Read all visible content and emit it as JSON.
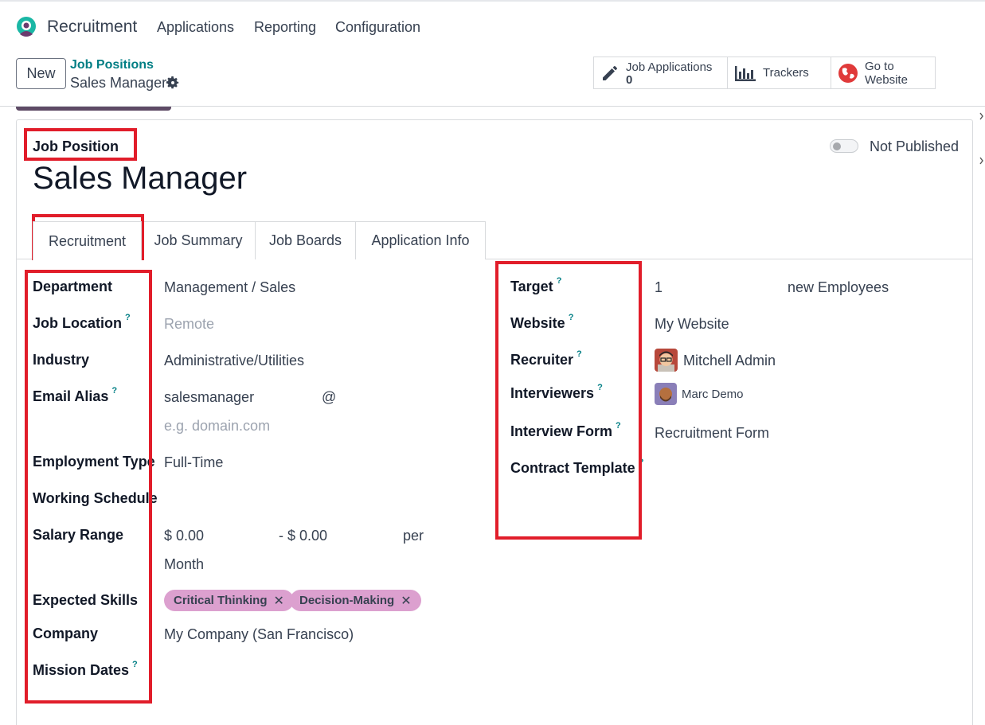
{
  "app": {
    "name": "Recruitment",
    "menu": [
      "Applications",
      "Reporting",
      "Configuration"
    ]
  },
  "control": {
    "new_label": "New",
    "breadcrumb_parent": "Job Positions",
    "breadcrumb_current": "Sales Manager",
    "smart_buttons": {
      "job_applications": {
        "label": "Job Applications",
        "value": "0"
      },
      "trackers": {
        "label": "Trackers"
      },
      "website": {
        "label_line1": "Go to",
        "label_line2": "Website"
      }
    }
  },
  "form": {
    "job_position_label": "Job Position",
    "title": "Sales Manager",
    "publish_status": "Not Published",
    "tabs": [
      "Recruitment",
      "Job Summary",
      "Job Boards",
      "Application Info"
    ],
    "left": {
      "department": {
        "label": "Department",
        "value": "Management / Sales"
      },
      "job_location": {
        "label": "Job Location",
        "help": "?",
        "placeholder": "Remote"
      },
      "industry": {
        "label": "Industry",
        "value": "Administrative/Utilities"
      },
      "email_alias": {
        "label": "Email Alias",
        "help": "?",
        "value": "salesmanager",
        "at": "@",
        "domain_placeholder": "e.g. domain.com"
      },
      "employment_type": {
        "label": "Employment Type",
        "value": "Full-Time"
      },
      "working_schedule": {
        "label": "Working Schedule"
      },
      "salary_range": {
        "label": "Salary Range",
        "min": "$ 0.00",
        "max": "- $ 0.00",
        "per": "per",
        "period": "Month"
      },
      "expected_skills": {
        "label": "Expected Skills",
        "tags": [
          "Critical Thinking",
          "Decision-Making"
        ],
        "remove_glyph": "✕"
      },
      "company": {
        "label": "Company",
        "value": "My Company (San Francisco)"
      },
      "mission_dates": {
        "label": "Mission Dates",
        "help": "?"
      }
    },
    "right": {
      "target": {
        "label": "Target",
        "help": "?",
        "value": "1",
        "unit": "new Employees"
      },
      "website": {
        "label": "Website",
        "help": "?",
        "value": "My Website"
      },
      "recruiter": {
        "label": "Recruiter",
        "help": "?",
        "value": "Mitchell Admin"
      },
      "interviewers": {
        "label": "Interviewers",
        "help": "?",
        "value": "Marc Demo"
      },
      "interview_form": {
        "label": "Interview Form",
        "help": "?",
        "value": "Recruitment Form"
      },
      "contract_template": {
        "label": "Contract Template",
        "help": "?"
      }
    }
  },
  "colors": {
    "accent": "#017e84",
    "annotation": "#e11d2a",
    "tag": "#dca0cf"
  }
}
